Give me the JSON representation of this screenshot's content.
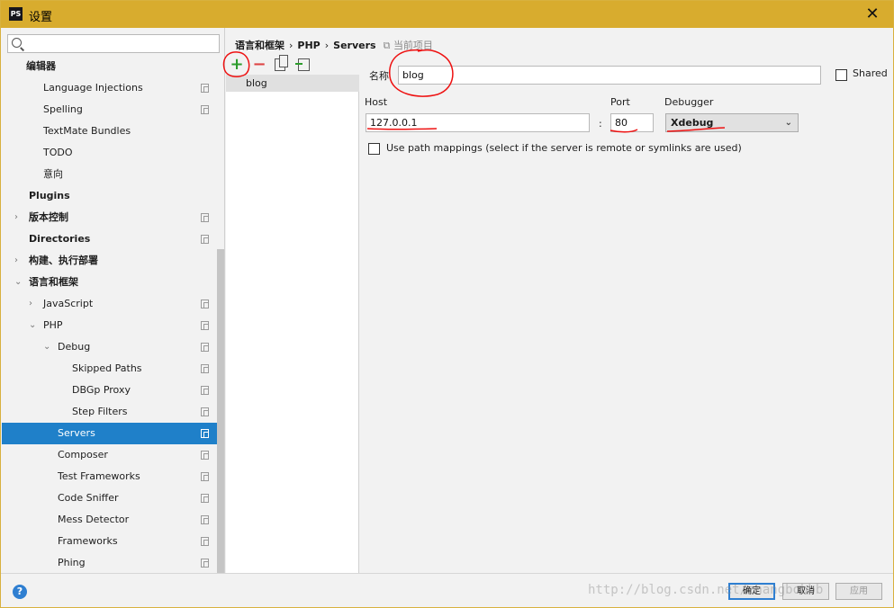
{
  "window": {
    "title": "设置",
    "app_icon": "PS"
  },
  "search": {
    "placeholder": ""
  },
  "tree": [
    {
      "label": "编辑器",
      "bold": true
    },
    {
      "label": "Language Injections"
    },
    {
      "label": "Spelling"
    },
    {
      "label": "TextMate Bundles"
    },
    {
      "label": "TODO"
    },
    {
      "label": "意向"
    },
    {
      "label": "Plugins",
      "bold": true
    },
    {
      "label": "版本控制",
      "bold": true
    },
    {
      "label": "Directories",
      "bold": true
    },
    {
      "label": "构建、执行部署",
      "bold": true
    },
    {
      "label": "语言和框架",
      "bold": true
    },
    {
      "label": "JavaScript"
    },
    {
      "label": "PHP"
    },
    {
      "label": "Debug"
    },
    {
      "label": "Skipped Paths"
    },
    {
      "label": "DBGp Proxy"
    },
    {
      "label": "Step Filters"
    },
    {
      "label": "Servers",
      "selected": true
    },
    {
      "label": "Composer"
    },
    {
      "label": "Test Frameworks"
    },
    {
      "label": "Code Sniffer"
    },
    {
      "label": "Mess Detector"
    },
    {
      "label": "Frameworks"
    },
    {
      "label": "Phing"
    }
  ],
  "breadcrumb": {
    "part1": "语言和框架",
    "sep1": "›",
    "part2": "PHP",
    "sep2": "›",
    "part3": "Servers",
    "scope": "当前项目"
  },
  "toolbar": {
    "add": "+",
    "remove": "−"
  },
  "servers": [
    "blog"
  ],
  "form": {
    "name_label": "名称",
    "name_value": "blog",
    "shared_label": "Shared",
    "host_label": "Host",
    "host_value": "127.0.0.1",
    "colon": ":",
    "port_label": "Port",
    "port_value": "80",
    "debugger_label": "Debugger",
    "debugger_value": "Xdebug",
    "path_mapping_label": "Use path mappings (select if the server is remote or symlinks are used)"
  },
  "footer": {
    "help": "?",
    "ok": "确定",
    "cancel": "取消",
    "apply": "应用"
  },
  "watermark": "http://blog.csdn.net/zhangbobbb"
}
